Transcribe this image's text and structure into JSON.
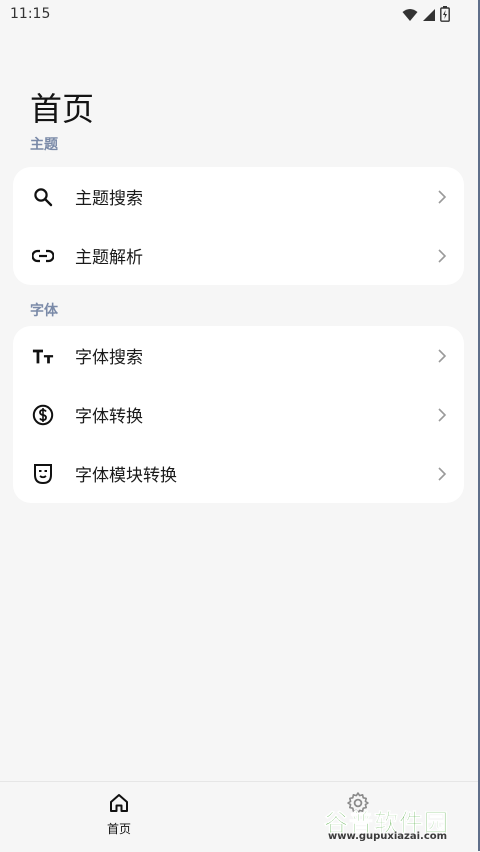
{
  "status_bar": {
    "time": "11:15",
    "icons": [
      "wifi-icon",
      "signal-icon",
      "battery-icon"
    ]
  },
  "page": {
    "title": "首页"
  },
  "sections": [
    {
      "label": "主题",
      "items": [
        {
          "label": "主题搜索",
          "icon": "search-icon"
        },
        {
          "label": "主题解析",
          "icon": "link-icon"
        }
      ]
    },
    {
      "label": "字体",
      "items": [
        {
          "label": "字体搜索",
          "icon": "text-size-icon"
        },
        {
          "label": "字体转换",
          "icon": "currency-exchange-icon"
        },
        {
          "label": "字体模块转换",
          "icon": "mask-icon"
        }
      ]
    }
  ],
  "bottom_nav": {
    "home_label": "首页",
    "home_icon": "home-icon",
    "settings_icon": "gear-icon"
  },
  "watermark": {
    "text": "谷普软件园",
    "url": "www.gupuxiazai.com"
  },
  "colors": {
    "background": "#f6f6f6",
    "card": "#ffffff",
    "section_label": "#7a8aa8",
    "watermark_green": "#4aa63a"
  }
}
